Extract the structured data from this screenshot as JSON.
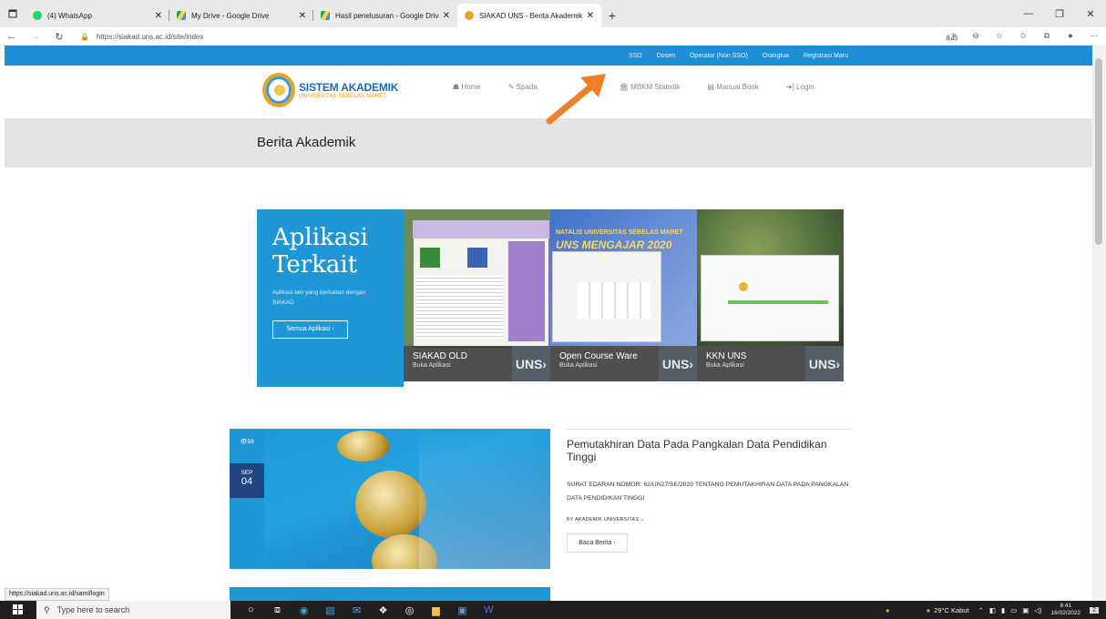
{
  "browser": {
    "tabs": [
      {
        "title": "(4) WhatsApp",
        "fav_color": "#25d366"
      },
      {
        "title": "My Drive - Google Drive",
        "fav_color": "#f5b400"
      },
      {
        "title": "Hasil penelusuran - Google Drive",
        "fav_color": "#f5b400"
      },
      {
        "title": "SIAKAD UNS - Berita Akademik",
        "fav_color": "#e9a32b"
      }
    ],
    "url": "https://siakad.uns.ac.id/site/index",
    "status_url": "https://siakad.uns.ac.id/saml/login"
  },
  "topbar": {
    "links": [
      "SSO",
      "Dosen",
      "Operator (Non SSO)",
      "Orangtua",
      "Registrasi Maru"
    ]
  },
  "logo": {
    "title": "SISTEM AKADEMIK",
    "subtitle": "UNIVERSITAS SEBELAS MARET"
  },
  "nav": {
    "home": "☗ Home",
    "spada": "✎ Spada",
    "mbkm": "🏛 MBKM Statistik",
    "manual": "▤ Manual Book",
    "login": "➜] Login"
  },
  "page": {
    "title": "Berita Akademik"
  },
  "apps": {
    "heading_1": "Aplikasi",
    "heading_2": "Terkait",
    "desc": "Aplikasi lain yang berkaitan dengan SIAKAD",
    "button": "Semua Aplikasi ›",
    "cards": [
      {
        "name": "SIAKAD OLD",
        "sub": "Buka Aplikasi",
        "badge": "UNS›"
      },
      {
        "name": "Open Course Ware",
        "sub": "Buka Aplikasi",
        "badge": "UNS›"
      },
      {
        "name": "KKN UNS",
        "sub": "Buka Aplikasi",
        "badge": "UNS›"
      }
    ],
    "card_banner_text": "NATALIS UNIVERSITAS SEBELAS MARET",
    "card_banner_big": "UNS MENGAJAR 2020"
  },
  "news": {
    "views": "👁59",
    "month": "SEP",
    "day": "04",
    "title": "Pemutakhiran Data Pada Pangkalan Data Pendidikan Tinggi",
    "excerpt": "SURAT EDARAN NOMOR: 62/UN27/SE/2020 TENTANG PEMUTAKHIRAN DATA PADA PANGKALAN DATA PENDIDIKAN TINGGI",
    "by": "BY   AKADEMIK UNIVERSITAS  ⌄",
    "more": "Baca Berita ›"
  },
  "taskbar": {
    "search": "Type here to search",
    "weather": "29°C  Kabut",
    "time": "8:41",
    "date": "16/02/2022",
    "notif": "2"
  },
  "colors": {
    "brand_blue": "#1f96d6",
    "topbar_blue": "#1e8fd6",
    "date_navy": "#21467d",
    "arrow": "#f07f2a"
  }
}
